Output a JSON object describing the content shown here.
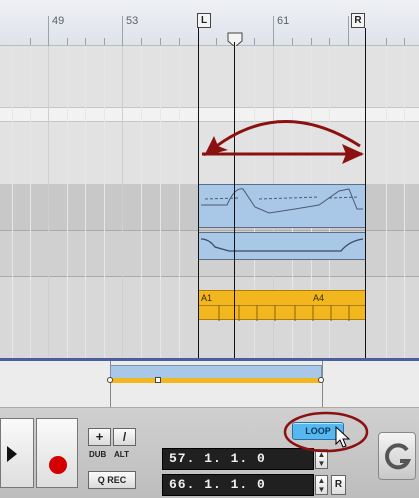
{
  "ruler": {
    "bars": [
      "49",
      "53",
      "61"
    ],
    "left_locator": "L",
    "right_locator": "R"
  },
  "clips": {
    "audio_labels": [
      "A1",
      "A4"
    ]
  },
  "transport": {
    "plus_label": "+",
    "slash_label": "/",
    "dub_label": "DUB",
    "alt_label": "ALT",
    "qrec_label": "Q REC",
    "loop_label": "LOOP",
    "left_locator_value": "57. 1. 1.   0",
    "right_locator_value": "66. 1. 1.   0",
    "r_label": "R"
  },
  "colors": {
    "loop_button": "#57b8f0",
    "record": "#d40000",
    "audio_clip": "#f2b61e",
    "midi_clip": "#a9c7e6",
    "annotation": "#8b1111"
  },
  "icons": [
    "play-icon",
    "record-icon",
    "plus-icon",
    "slash-icon",
    "up-arrow-icon",
    "down-arrow-icon",
    "click-icon",
    "cursor-icon"
  ]
}
